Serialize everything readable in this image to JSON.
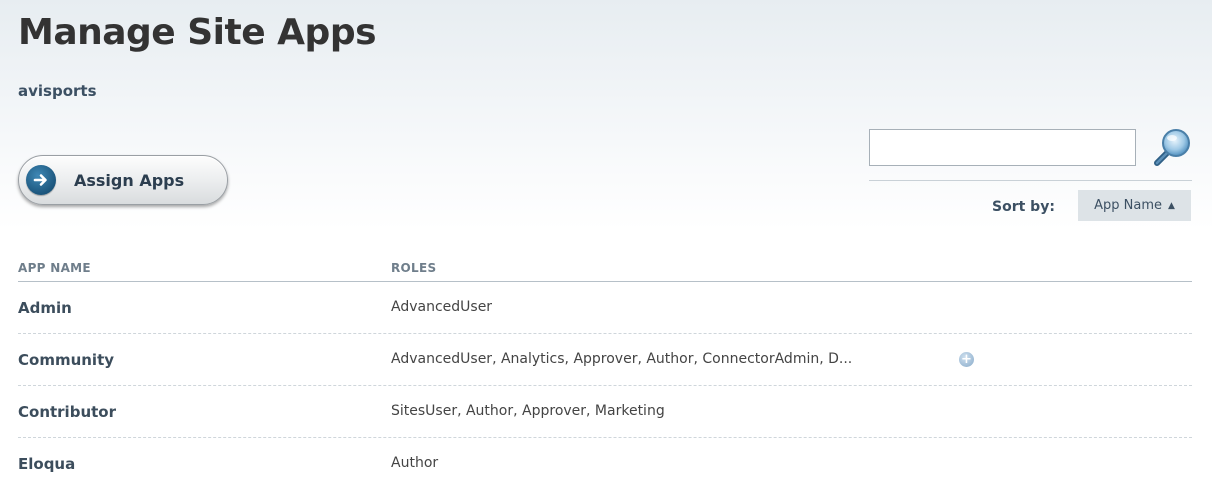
{
  "page": {
    "title": "Manage Site Apps",
    "site": "avisports"
  },
  "toolbar": {
    "assign_label": "Assign Apps",
    "assign_icon": "arrow-right-circle-icon"
  },
  "search": {
    "value": "",
    "placeholder": "",
    "icon": "magnifier-icon"
  },
  "sort": {
    "label": "Sort by:",
    "selected": "App Name",
    "direction_icon": "caret-up-icon"
  },
  "table": {
    "columns": [
      "APP NAME",
      "ROLES"
    ],
    "rows": [
      {
        "app": "Admin",
        "roles": "AdvancedUser",
        "more": false
      },
      {
        "app": "Community",
        "roles": "AdvancedUser, Analytics, Approver, Author, ConnectorAdmin, D...",
        "more": true
      },
      {
        "app": "Contributor",
        "roles": "SitesUser, Author, Approver, Marketing",
        "more": false
      },
      {
        "app": "Eloqua",
        "roles": "Author",
        "more": false
      }
    ]
  },
  "colors": {
    "heading": "#333333",
    "accent_blue": "#174f75",
    "sort_bg": "#dde3e7"
  }
}
